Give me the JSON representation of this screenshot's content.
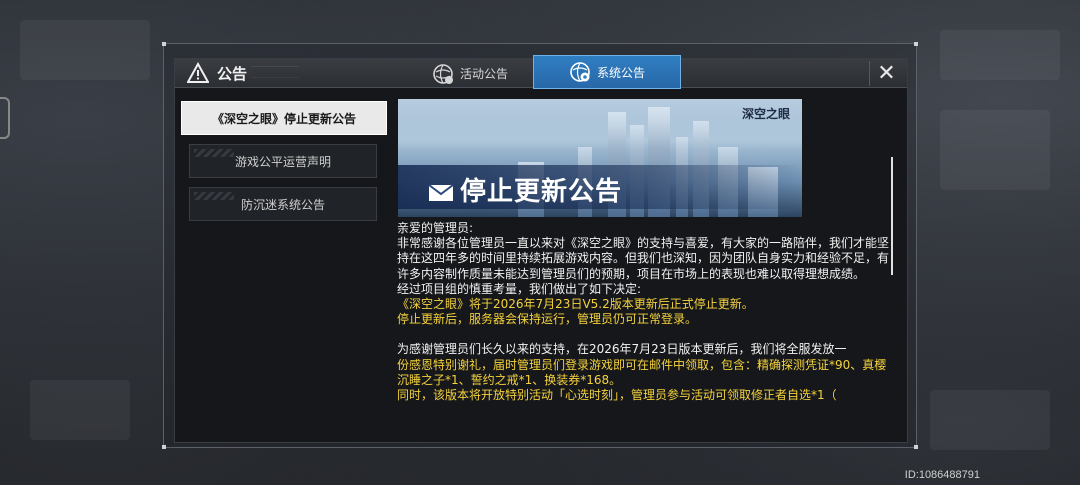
{
  "dialog": {
    "header_title": "公告",
    "tabs": [
      {
        "label": "活动公告",
        "active": false
      },
      {
        "label": "系统公告",
        "active": true
      }
    ],
    "close_label": "✕"
  },
  "sidebar": {
    "items": [
      {
        "label": "《深空之眼》停止更新公告",
        "active": true
      },
      {
        "label": "游戏公平运营声明",
        "active": false
      },
      {
        "label": "防沉迷系统公告",
        "active": false
      }
    ]
  },
  "banner": {
    "title": "停止更新公告",
    "logo": "深空之眼"
  },
  "notice": {
    "greeting": "亲爱的管理员:",
    "para1": "非常感谢各位管理员一直以来对《深空之眼》的支持与喜爱，有大家的一路陪伴，我们才能坚持在这四年多的时间里持续拓展游戏内容。但我们也深知，因为团队自身实力和经验不足，有许多内容制作质量未能达到管理员们的预期，项目在市场上的表现也难以取得理想成绩。",
    "para2": "经过项目组的慎重考量，我们做出了如下决定:",
    "decision1": "《深空之眼》将于2026年7月23日V5.2版本更新后正式停止更新。",
    "decision2": "停止更新后，服务器会保持运行，管理员仍可正常登录。",
    "para3_white": "为感谢管理员们长久以来的支持，在2026年7月23日版本更新后，我们将全服发放一",
    "para3_yellow": "份感恩特别谢礼，届时管理员们登录游戏即可在邮件中领取，包含：精确探测凭证*90、真樱沉睡之子*1、誓约之戒*1、换装券*168。",
    "para4": "同时，该版本将开放特别活动「心选时刻」，管理员参与活动可领取修正者自选*1（"
  },
  "footer": {
    "id_label": "ID:1086488791"
  },
  "colors": {
    "accent_tab": "#2f7ec2",
    "highlight_text": "#f5d23d"
  }
}
